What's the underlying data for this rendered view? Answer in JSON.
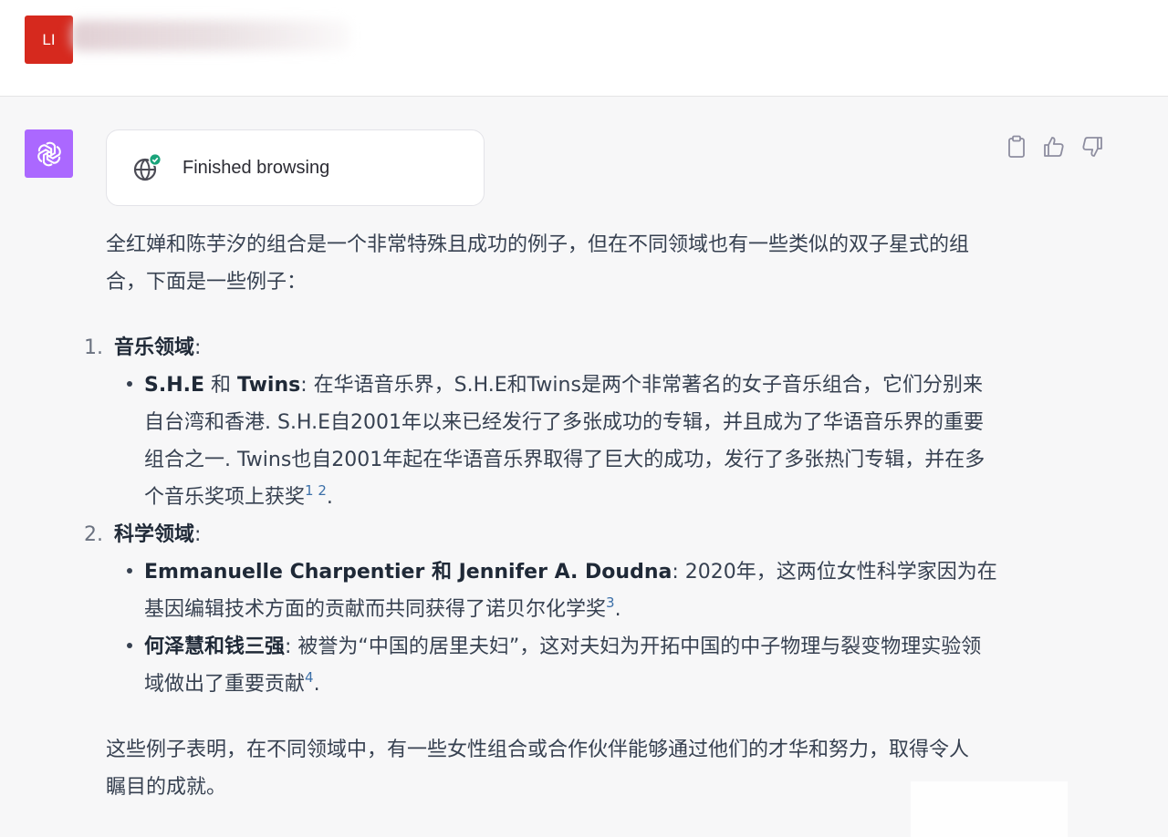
{
  "user": {
    "avatar_initials": "LI",
    "avatar_color": "#d6291e"
  },
  "assistant": {
    "avatar_color": "#ab68ff",
    "avatar_icon": "openai-logo-icon",
    "browse_card": {
      "label": "Finished browsing",
      "icon": "globe-check-icon"
    },
    "actions": [
      {
        "name": "copy",
        "icon": "clipboard-icon"
      },
      {
        "name": "thumbs-up",
        "icon": "thumbs-up-icon"
      },
      {
        "name": "thumbs-down",
        "icon": "thumbs-down-icon"
      }
    ],
    "intro": "全红婵和陈芋汐的组合是一个非常特殊且成功的例子，但在不同领域也有一些类似的双子星式的组合，下面是一些例子：",
    "sections": [
      {
        "number": "1.",
        "title": "音乐领域",
        "items": [
          {
            "bold": "S.H.E",
            "mid": " 和 ",
            "bold2": "Twins",
            "text": ": 在华语音乐界，S.H.E和Twins是两个非常著名的女子音乐组合，它们分别来自台湾和香港. S.H.E自2001年以来已经发行了多张成功的专辑，并且成为了华语音乐界的重要组合之一. Twins也自2001年起在华语音乐界取得了巨大的成功，发行了多张热门专辑，并在多个音乐奖项上获奖",
            "cites": "1 2",
            "end": "."
          }
        ]
      },
      {
        "number": "2.",
        "title": "科学领域",
        "items": [
          {
            "bold": "Emmanuelle Charpentier 和 Jennifer A. Doudna",
            "text": ": 2020年，这两位女性科学家因为在基因编辑技术方面的贡献而共同获得了诺贝尔化学奖",
            "cites": "3",
            "end": "."
          },
          {
            "bold": "何泽慧和钱三强",
            "text": ": 被誉为“中国的居里夫妇”，这对夫妇为开拓中国的中子物理与裂变物理实验领域做出了重要贡献",
            "cites": "4",
            "end": "."
          }
        ]
      }
    ],
    "outro": "这些例子表明，在不同领域中，有一些女性组合或合作伙伴能够通过他们的才华和努力，取得令人瞩目的成就。"
  }
}
